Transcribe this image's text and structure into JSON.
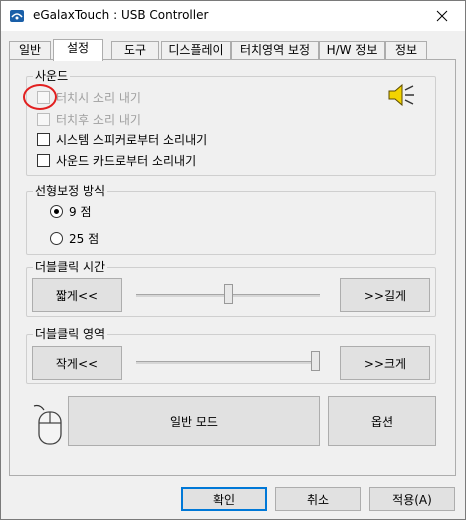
{
  "window": {
    "title": "eGalaxTouch : USB Controller"
  },
  "tabs": [
    "일반",
    "설정",
    "도구",
    "디스플레이",
    "터치영역 보정",
    "H/W 정보",
    "정보"
  ],
  "active_tab": "설정",
  "sound": {
    "title": "사운드",
    "options": [
      {
        "label": "터치시 소리 내기",
        "checked": false,
        "enabled": false
      },
      {
        "label": "터치후 소리 내기",
        "checked": false,
        "enabled": false
      },
      {
        "label": "시스템 스피커로부터 소리내기",
        "checked": false,
        "enabled": true
      },
      {
        "label": "사운드 카드로부터 소리내기",
        "checked": false,
        "enabled": true
      }
    ]
  },
  "linearity": {
    "title": "선형보정 방식",
    "options": [
      {
        "label": "9 점",
        "checked": true
      },
      {
        "label": "25 점",
        "checked": false
      }
    ]
  },
  "dbl_click_time": {
    "title": "더블클릭 시간",
    "left_button": "짧게<<",
    "right_button": ">>길게",
    "slider_value": 0.5
  },
  "dbl_click_area": {
    "title": "더블클릭 영역",
    "left_button": "작게<<",
    "right_button": ">>크게",
    "slider_value": 1.0
  },
  "mode_button": "일반 모드",
  "options_button": "옵션",
  "footer": {
    "ok": "확인",
    "cancel": "취소",
    "apply": "적용(A)"
  },
  "colors": {
    "accent": "#0078d7",
    "highlight_circle": "#e22020"
  }
}
